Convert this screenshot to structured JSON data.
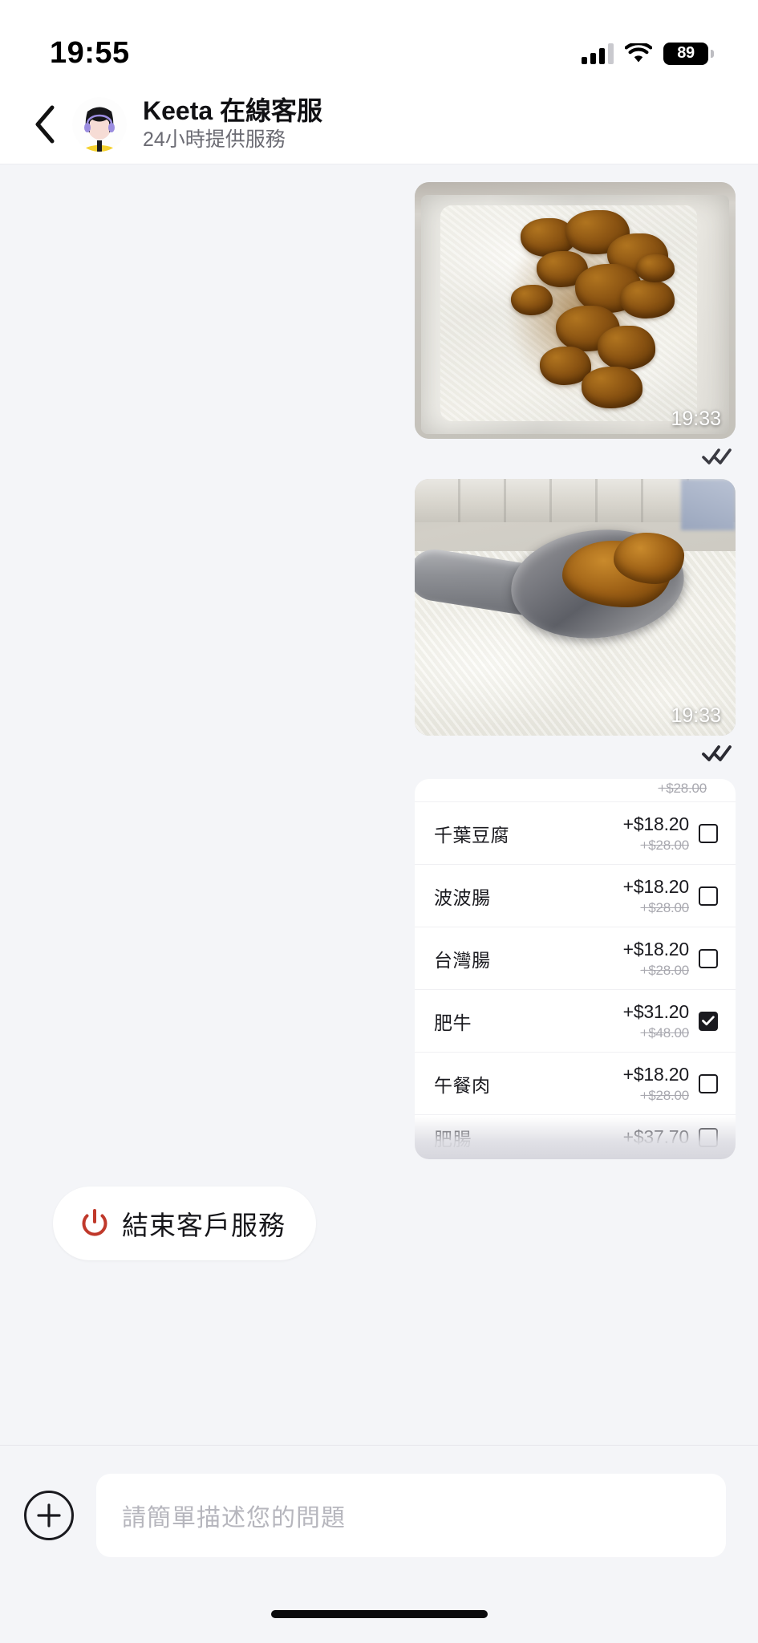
{
  "status_bar": {
    "time": "19:55",
    "battery_level": "89",
    "signal_icon": "cellular-signal-icon",
    "wifi_icon": "wifi-icon",
    "battery_icon": "battery-icon"
  },
  "header": {
    "back_icon": "chevron-left-icon",
    "avatar_icon": "agent-avatar",
    "title": "Keeta 在線客服",
    "subtitle": "24小時提供服務"
  },
  "messages": [
    {
      "type": "image",
      "name": "photo-rice-with-pork",
      "timestamp": "19:33",
      "status_icon": "double-check-icon"
    },
    {
      "type": "image",
      "name": "photo-spoon-with-meat",
      "timestamp": "19:33",
      "status_icon": "double-check-icon"
    }
  ],
  "menu_card": {
    "clipped_top_price": "+$28.00",
    "rows": [
      {
        "name": "千葉豆腐",
        "price": "+$18.20",
        "old_price": "+$28.00",
        "checked": false
      },
      {
        "name": "波波腸",
        "price": "+$18.20",
        "old_price": "+$28.00",
        "checked": false
      },
      {
        "name": "台灣腸",
        "price": "+$18.20",
        "old_price": "+$28.00",
        "checked": false
      },
      {
        "name": "肥牛",
        "price": "+$31.20",
        "old_price": "+$48.00",
        "checked": true
      },
      {
        "name": "午餐肉",
        "price": "+$18.20",
        "old_price": "+$28.00",
        "checked": false
      },
      {
        "name": "肥腸",
        "price": "+$37.70",
        "old_price": "",
        "checked": false
      }
    ]
  },
  "end_service_button": {
    "label": "結束客戶服務",
    "icon": "power-icon",
    "icon_color": "#c0392b"
  },
  "composer": {
    "add_icon": "plus-circle-icon",
    "placeholder": "請簡單描述您的問題",
    "value": ""
  },
  "home_indicator": "home-bar"
}
